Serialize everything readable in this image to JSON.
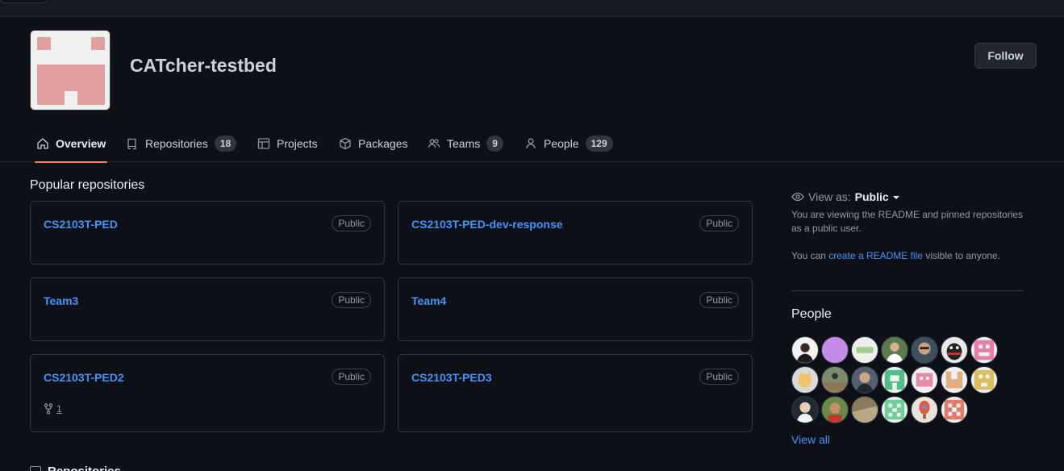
{
  "org": {
    "name": "CATcher-testbed",
    "follow_label": "Follow"
  },
  "tabs": [
    {
      "label": "Overview",
      "icon": "home-icon"
    },
    {
      "label": "Repositories",
      "icon": "repo-icon",
      "count": "18"
    },
    {
      "label": "Projects",
      "icon": "table-icon"
    },
    {
      "label": "Packages",
      "icon": "package-icon"
    },
    {
      "label": "Teams",
      "icon": "people-icon",
      "count": "9"
    },
    {
      "label": "People",
      "icon": "person-icon",
      "count": "129"
    }
  ],
  "popular": {
    "title": "Popular repositories",
    "repos": [
      {
        "name": "CS2103T-PED",
        "visibility": "Public"
      },
      {
        "name": "CS2103T-PED-dev-response",
        "visibility": "Public"
      },
      {
        "name": "Team3",
        "visibility": "Public"
      },
      {
        "name": "Team4",
        "visibility": "Public"
      },
      {
        "name": "CS2103T-PED2",
        "visibility": "Public",
        "forks": "1"
      },
      {
        "name": "CS2103T-PED3",
        "visibility": "Public"
      }
    ]
  },
  "repositories_heading": "Repositories",
  "sidebar": {
    "view_as_label": "View as:",
    "view_as_value": "Public",
    "viewing_text": "You are viewing the README and pinned repositories as a public user.",
    "readme_prefix": "You can ",
    "readme_link": "create a README file",
    "readme_suffix": " visible to anyone.",
    "people_title": "People",
    "view_all": "View all"
  },
  "colors": {
    "accent_link": "#4493f8",
    "tab_underline": "#f78166",
    "org_avatar_pink": "#e0a0a0"
  }
}
